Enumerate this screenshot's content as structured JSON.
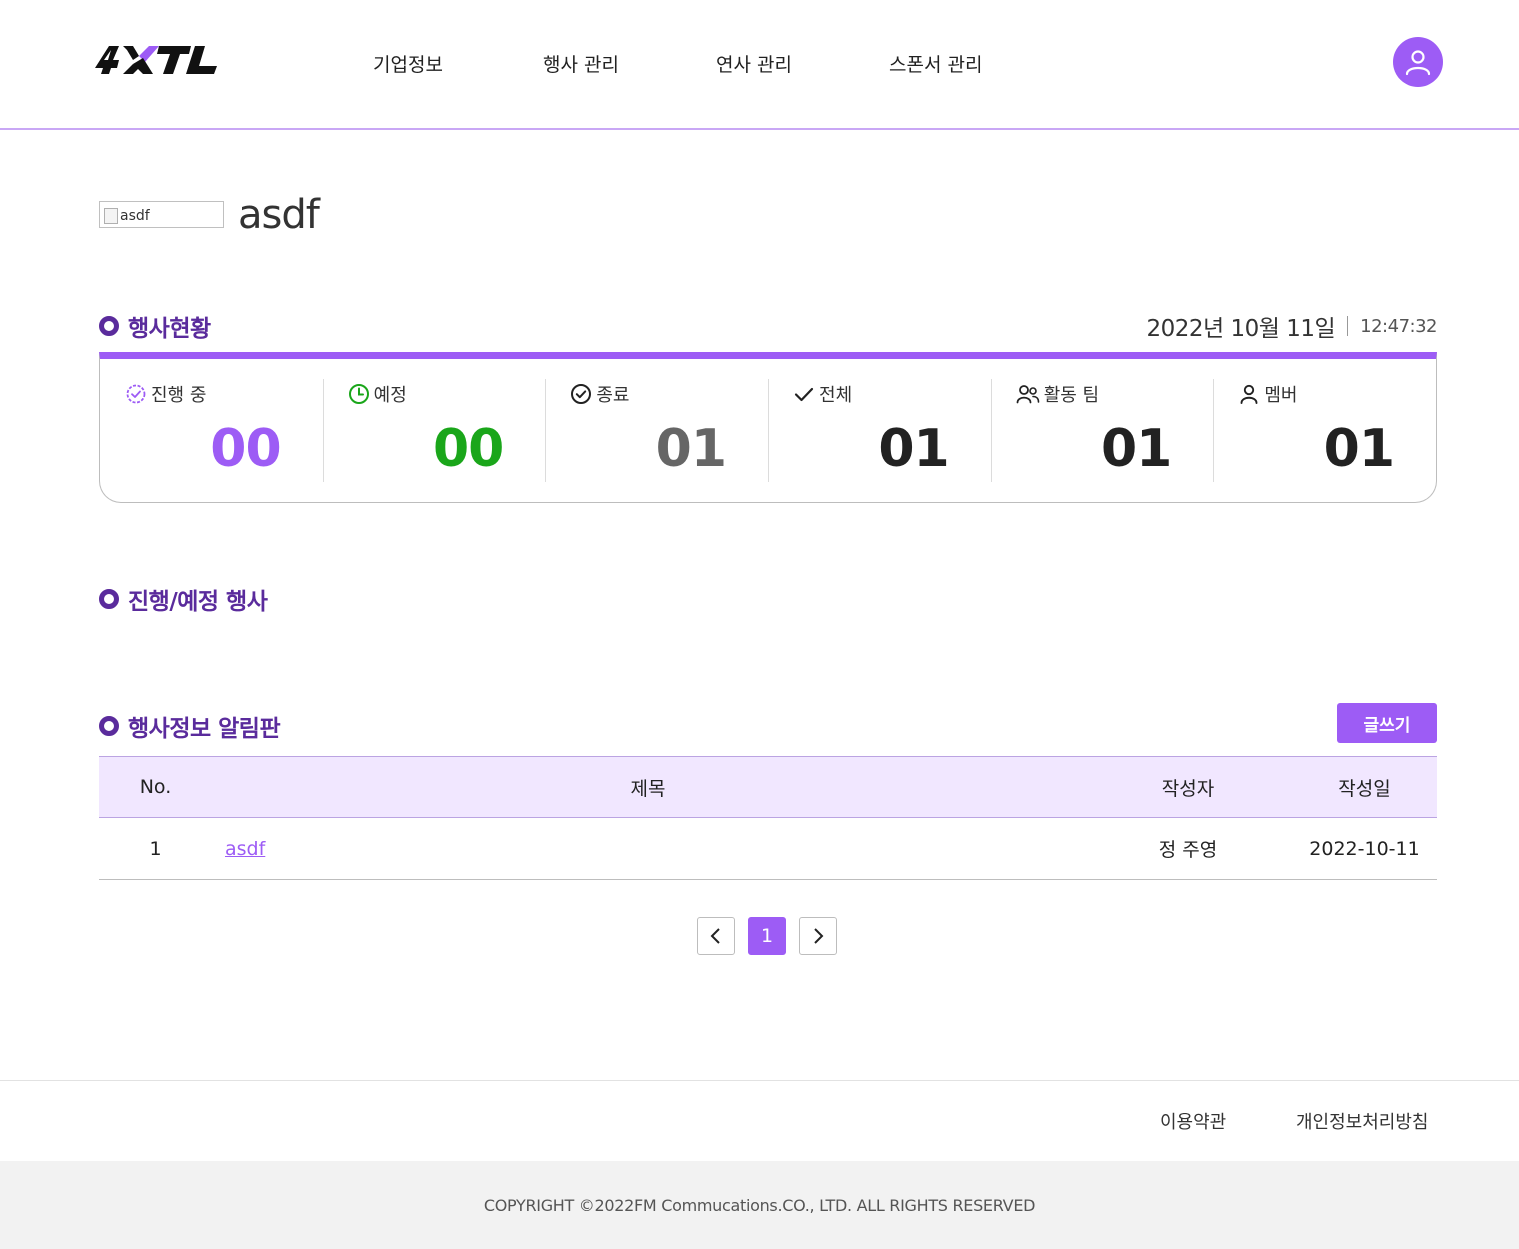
{
  "header": {
    "logo_text": "4XTL",
    "nav": [
      "기업정보",
      "행사 관리",
      "연사 관리",
      "스폰서 관리"
    ]
  },
  "company": {
    "image_alt": "asdf",
    "name": "asdf"
  },
  "status_section": {
    "title": "행사현황",
    "date": "2022년 10월 11일",
    "time": "12:47:32",
    "stats": [
      {
        "label": "진행 중",
        "value": "00",
        "icon": "progress-badge-icon",
        "color": "#9d5cf5"
      },
      {
        "label": "예정",
        "value": "00",
        "icon": "clock-icon",
        "color": "#1aa61a"
      },
      {
        "label": "종료",
        "value": "01",
        "icon": "check-circle-icon",
        "color": "#666666"
      },
      {
        "label": "전체",
        "value": "01",
        "icon": "check-icon",
        "color": "#222222"
      },
      {
        "label": "활동 팀",
        "value": "01",
        "icon": "team-icon",
        "color": "#222222"
      },
      {
        "label": "멤버",
        "value": "01",
        "icon": "member-icon",
        "color": "#222222"
      }
    ]
  },
  "ongoing_section": {
    "title": "진행/예정 행사"
  },
  "notice_section": {
    "title": "행사정보 알림판",
    "write_button": "글쓰기",
    "columns": [
      "No.",
      "제목",
      "작성자",
      "작성일"
    ],
    "rows": [
      {
        "no": "1",
        "title": "asdf",
        "author": "정 주영",
        "date": "2022-10-11"
      }
    ]
  },
  "pagination": {
    "current": "1"
  },
  "footer": {
    "links": [
      "이용약관",
      "개인정보처리방침"
    ],
    "copyright": "COPYRIGHT ©2022FM Commucations.CO., LTD. ALL RIGHTS RESERVED"
  },
  "colors": {
    "accent": "#9d5cf5",
    "section_title": "#5a2b9c",
    "table_header_bg": "#f1e7ff"
  }
}
